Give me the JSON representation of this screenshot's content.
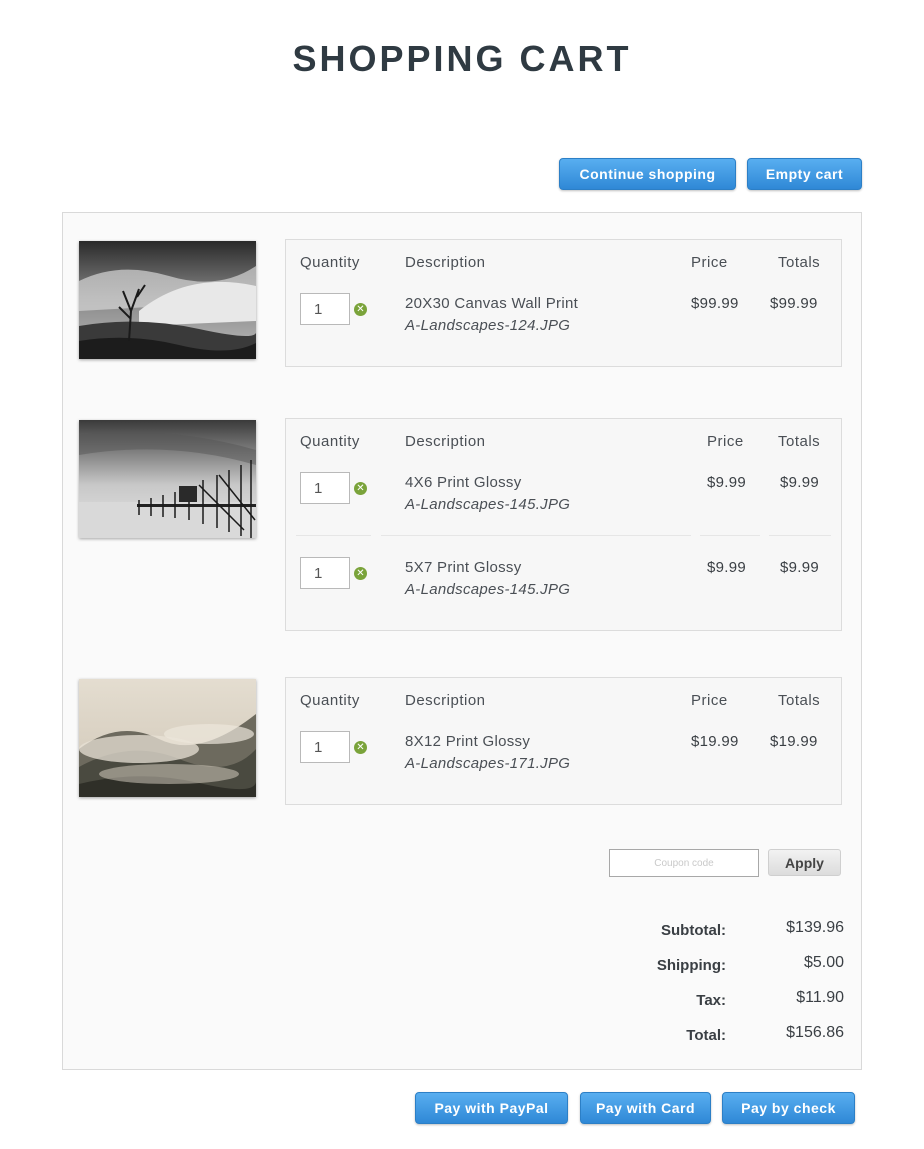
{
  "page": {
    "title": "SHOPPING CART"
  },
  "top_actions": {
    "continue_label": "Continue shopping",
    "empty_label": "Empty cart"
  },
  "columns": {
    "quantity": "Quantity",
    "description": "Description",
    "price": "Price",
    "totals": "Totals"
  },
  "items": [
    {
      "image": "black-and-white landscape with bare tree and sand dunes",
      "lines": [
        {
          "qty": "1",
          "description": "20X30 Canvas Wall Print",
          "file": "A-Landscapes-124.JPG",
          "price": "$99.99",
          "total": "$99.99"
        }
      ]
    },
    {
      "image": "black-and-white long-exposure pier over water",
      "lines": [
        {
          "qty": "1",
          "description": "4X6 Print Glossy",
          "file": "A-Landscapes-145.JPG",
          "price": "$9.99",
          "total": "$9.99"
        },
        {
          "qty": "1",
          "description": "5X7 Print Glossy",
          "file": "A-Landscapes-145.JPG",
          "price": "$9.99",
          "total": "$9.99"
        }
      ]
    },
    {
      "image": "misty forested hills",
      "lines": [
        {
          "qty": "1",
          "description": "8X12 Print Glossy",
          "file": "A-Landscapes-171.JPG",
          "price": "$19.99",
          "total": "$19.99"
        }
      ]
    }
  ],
  "coupon": {
    "placeholder": "Coupon code",
    "apply_label": "Apply"
  },
  "summary": {
    "subtotal_label": "Subtotal:",
    "subtotal": "$139.96",
    "shipping_label": "Shipping:",
    "shipping": "$5.00",
    "tax_label": "Tax:",
    "tax": "$11.90",
    "total_label": "Total:",
    "total": "$156.86"
  },
  "payment": {
    "paypal_label": "Pay with PayPal",
    "card_label": "Pay with Card",
    "check_label": "Pay by check"
  },
  "icons": {
    "remove": "remove-x-icon"
  },
  "colors": {
    "button_blue": "#3a94dd",
    "remove_green": "#7aa33a",
    "panel_bg": "#fafafa"
  }
}
